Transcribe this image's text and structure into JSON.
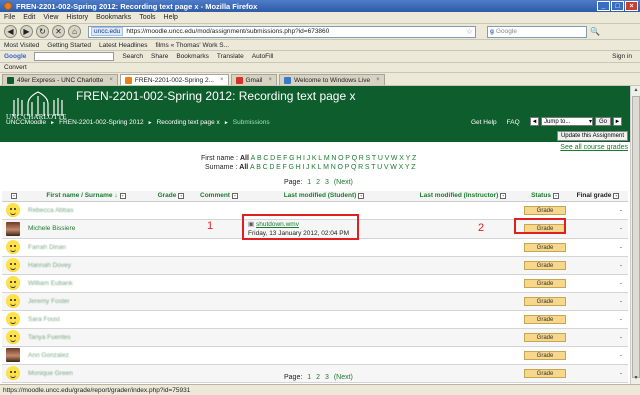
{
  "window": {
    "title": "FREN-2201-002-Spring 2012: Recording text page x - Mozilla Firefox"
  },
  "menu": [
    "File",
    "Edit",
    "View",
    "History",
    "Bookmarks",
    "Tools",
    "Help"
  ],
  "address": {
    "domain": "uncc.edu",
    "url": "https://moodle.uncc.edu/mod/assignment/submissions.php?id=673860",
    "search_placeholder": "Google"
  },
  "bookmarks": [
    "Most Visited",
    "Getting Started",
    "Latest Headlines",
    "films « Thomas' Work S..."
  ],
  "google_toolbar": {
    "label": "Google",
    "items": [
      "Search",
      "Share",
      "Bookmarks",
      "Translate",
      "AutoFill",
      "Sign in"
    ]
  },
  "convert_label": "Convert",
  "tabs": [
    {
      "label": "49er Express - UNC Charlotte",
      "active": false
    },
    {
      "label": "FREN-2201-002-Spring 2...",
      "active": true
    },
    {
      "label": "Gmail",
      "active": false
    },
    {
      "label": "Welcome to Windows Live",
      "active": false
    }
  ],
  "header": {
    "logo_text": "UNC CHARLOTTE",
    "course_title": "FREN-2201-002-Spring 2012: Recording text page x",
    "breadcrumbs": [
      "UNCCMoodle",
      "FREN-2201-002-Spring 2012",
      "Recording text page x",
      "Submissions"
    ],
    "get_help": "Get Help",
    "faq": "FAQ",
    "jump_to": "Jump to...",
    "go": "Go"
  },
  "update_button": "Update this Assignment",
  "see_all_grades": "See all course grades",
  "first_name_filter": {
    "label": "First name :",
    "all": "All",
    "letters": [
      "A",
      "B",
      "C",
      "D",
      "E",
      "F",
      "G",
      "H",
      "I",
      "J",
      "K",
      "L",
      "M",
      "N",
      "O",
      "P",
      "Q",
      "R",
      "S",
      "T",
      "U",
      "V",
      "W",
      "X",
      "Y",
      "Z"
    ]
  },
  "surname_filter": {
    "label": "Surname :",
    "all": "All",
    "letters": [
      "A",
      "B",
      "C",
      "D",
      "E",
      "F",
      "G",
      "H",
      "I",
      "J",
      "K",
      "L",
      "M",
      "N",
      "O",
      "P",
      "Q",
      "R",
      "S",
      "T",
      "U",
      "V",
      "W",
      "X",
      "Y",
      "Z"
    ]
  },
  "paging": {
    "label": "Page:",
    "pages": [
      "1",
      "2",
      "3"
    ],
    "next": "(Next)"
  },
  "columns": {
    "name": "First name / Surname",
    "grade": "Grade",
    "comment": "Comment",
    "modified_student": "Last modified (Student)",
    "modified_instructor": "Last modified (Instructor)",
    "status": "Status",
    "final_grade": "Final grade"
  },
  "rows": [
    {
      "name": "Rebecca Abbas",
      "blurred": true,
      "photo": false,
      "file": "",
      "date": "",
      "grade_btn": "Grade",
      "final": "-"
    },
    {
      "name": "Michele Bissiere",
      "blurred": false,
      "photo": true,
      "file": "shutdown.wmv",
      "date": "Friday, 13 January 2012, 02:04 PM",
      "grade_btn": "Grade",
      "final": "-"
    },
    {
      "name": "Farrah Dinan",
      "blurred": true,
      "photo": false,
      "file": "",
      "date": "",
      "grade_btn": "Grade",
      "final": "-"
    },
    {
      "name": "Hannah Dovey",
      "blurred": true,
      "photo": false,
      "file": "",
      "date": "",
      "grade_btn": "Grade",
      "final": "-"
    },
    {
      "name": "William Eubank",
      "blurred": true,
      "photo": false,
      "file": "",
      "date": "",
      "grade_btn": "Grade",
      "final": "-"
    },
    {
      "name": "Jeremy Foster",
      "blurred": true,
      "photo": false,
      "file": "",
      "date": "",
      "grade_btn": "Grade",
      "final": "-"
    },
    {
      "name": "Sara Foust",
      "blurred": true,
      "photo": false,
      "file": "",
      "date": "",
      "grade_btn": "Grade",
      "final": "-"
    },
    {
      "name": "Tanya Fuentes",
      "blurred": true,
      "photo": false,
      "file": "",
      "date": "",
      "grade_btn": "Grade",
      "final": "-"
    },
    {
      "name": "Ann Gonzalez",
      "blurred": true,
      "photo": true,
      "file": "",
      "date": "",
      "grade_btn": "Grade",
      "final": "-"
    },
    {
      "name": "Monique Green",
      "blurred": true,
      "photo": false,
      "file": "",
      "date": "",
      "grade_btn": "Grade",
      "final": "-"
    }
  ],
  "annotations": {
    "one": "1",
    "two": "2"
  },
  "status_bar": "https://moodle.uncc.edu/grade/report/grader/index.php?id=75931",
  "colors": {
    "moodle_green": "#0e5d2c",
    "link_green": "#1a7c2e",
    "highlight_red": "#e02020",
    "grade_button": "#f7d78c"
  }
}
